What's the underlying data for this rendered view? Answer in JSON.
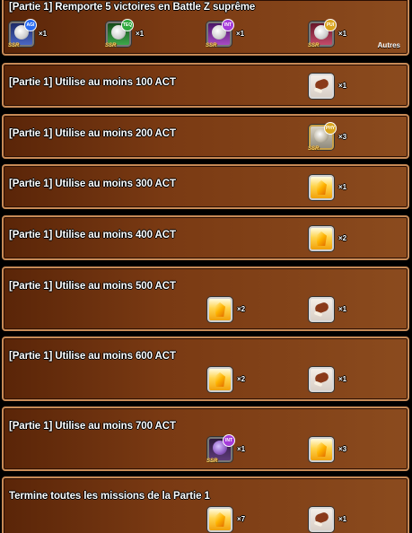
{
  "missions": [
    {
      "title": "[Partie 1] Remporte 5 victoires en Battle Z suprême",
      "other_label": "Autres",
      "rewards": [
        {
          "icon": "card-agi-icon",
          "badge": "AGI",
          "rarity": "SSR",
          "qty": "×1"
        },
        {
          "icon": "card-teq-icon",
          "badge": "TEQ",
          "rarity": "SSR",
          "qty": "×1"
        },
        {
          "icon": "card-int-icon",
          "badge": "INT",
          "rarity": "SSR",
          "qty": "×1"
        },
        {
          "icon": "card-phy-icon",
          "badge": "PUI",
          "rarity": "SSR",
          "qty": "×1"
        }
      ]
    },
    {
      "title": "[Partie 1] Utilise au moins 100 ACT",
      "rewards": [
        {
          "icon": "meat-icon",
          "qty": "×1"
        }
      ]
    },
    {
      "title": "[Partie 1] Utilise au moins 200 ACT",
      "rewards": [
        {
          "icon": "statue-card-icon",
          "badge": "PHY",
          "rarity": "SSR",
          "qty": "×3"
        }
      ]
    },
    {
      "title": "[Partie 1] Utilise au moins 300 ACT",
      "rewards": [
        {
          "icon": "medal-icon",
          "qty": "×1"
        }
      ]
    },
    {
      "title": "[Partie 1] Utilise au moins 400 ACT",
      "rewards": [
        {
          "icon": "medal-icon",
          "qty": "×2"
        }
      ]
    },
    {
      "title": "[Partie 1] Utilise au moins 500 ACT",
      "rewards": [
        {
          "icon": "medal-icon",
          "qty": "×2"
        },
        {
          "icon": "meat-icon",
          "qty": "×1"
        }
      ]
    },
    {
      "title": "[Partie 1] Utilise au moins 600 ACT",
      "rewards": [
        {
          "icon": "medal-icon",
          "qty": "×2"
        },
        {
          "icon": "meat-icon",
          "qty": "×1"
        }
      ]
    },
    {
      "title": "[Partie 1] Utilise au moins 700 ACT",
      "rewards": [
        {
          "icon": "card-str-icon",
          "badge": "INT",
          "rarity": "SSR",
          "qty": "×1"
        },
        {
          "icon": "medal-icon",
          "qty": "×3"
        }
      ]
    },
    {
      "title": "Termine toutes les missions de la Partie 1",
      "rewards": [
        {
          "icon": "medal-icon",
          "qty": "×7"
        },
        {
          "icon": "meat-icon",
          "qty": "×1"
        }
      ]
    }
  ],
  "colors": {
    "row_border": "#c78a56",
    "row_bg_dark": "#5a2508",
    "row_bg_light": "#8b4b1e"
  }
}
